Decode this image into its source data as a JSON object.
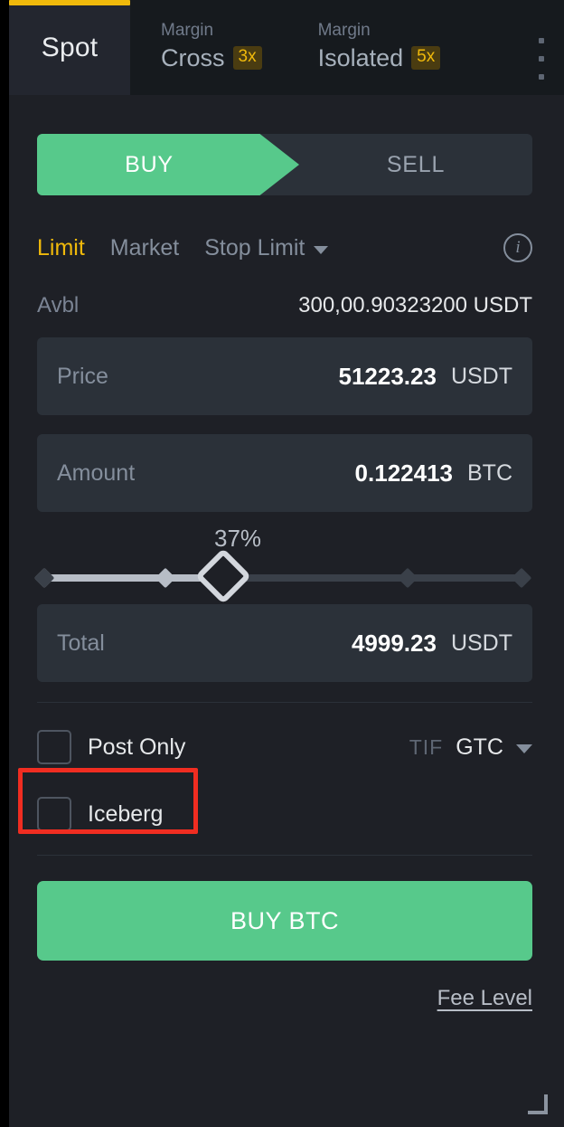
{
  "tabs": {
    "spot": {
      "label": "Spot",
      "active": true
    },
    "margin_cross": {
      "sub": "Margin",
      "main": "Cross",
      "leverage": "3x"
    },
    "margin_isolated": {
      "sub": "Margin",
      "main": "Isolated",
      "leverage": "5x"
    },
    "more_menu_icon": "kebab-menu-icon"
  },
  "side": {
    "buy_label": "BUY",
    "sell_label": "SELL",
    "active": "BUY"
  },
  "order_types": {
    "limit": "Limit",
    "market": "Market",
    "stop_limit": "Stop Limit",
    "active": "Limit",
    "info_icon": "info-icon",
    "dropdown_icon": "chevron-down-icon"
  },
  "available": {
    "label": "Avbl",
    "value": "300,00.90323200 USDT"
  },
  "price": {
    "label": "Price",
    "value": "51223.23",
    "unit": "USDT"
  },
  "amount": {
    "label": "Amount",
    "value": "0.122413",
    "unit": "BTC"
  },
  "slider": {
    "percent_label": "37%",
    "percent": 37,
    "ticks": [
      0,
      25,
      50,
      75,
      100
    ]
  },
  "total": {
    "label": "Total",
    "value": "4999.23",
    "unit": "USDT"
  },
  "options": {
    "post_only": {
      "label": "Post Only",
      "checked": false
    },
    "iceberg": {
      "label": "Iceberg",
      "checked": false
    }
  },
  "tif": {
    "label": "TIF",
    "value": "GTC",
    "dropdown_icon": "chevron-down-icon"
  },
  "submit": {
    "label": "BUY BTC"
  },
  "fee": {
    "label": "Fee Level"
  },
  "annotation": {
    "target": "post-only-checkbox",
    "color": "#f02d21"
  },
  "colors": {
    "accent": "#f0b90b",
    "buy_green": "#57c98b",
    "panel_bg": "#1e2026",
    "field_bg": "#2b3139",
    "tab_inactive_bg": "#161a1e",
    "annotation_red": "#f02d21"
  },
  "resize_handle_icon": "resize-corner-icon"
}
